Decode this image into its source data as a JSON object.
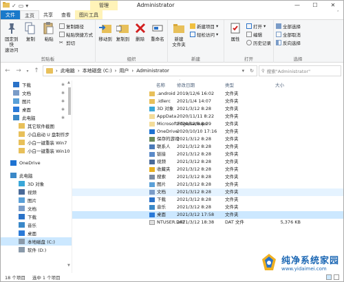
{
  "window": {
    "title": "Administrator",
    "context_tab_title": "管理",
    "buttons": {
      "minimize": "—",
      "maximize": "☐",
      "close": "✕"
    }
  },
  "ribbon_tabs": [
    {
      "label": "文件"
    },
    {
      "label": "主页"
    },
    {
      "label": "共享"
    },
    {
      "label": "查看"
    },
    {
      "label": "图片工具"
    }
  ],
  "ribbon": {
    "clipboard": {
      "label": "剪贴板",
      "pin": "固定到快\n速访问",
      "copy": "复制",
      "paste": "粘贴",
      "copy_path": "复制路径",
      "paste_shortcut": "粘贴快捷方式",
      "cut": "剪切"
    },
    "organize": {
      "label": "组织",
      "move_to": "移动到",
      "copy_to": "复制到",
      "delete": "删除",
      "rename": "重命名"
    },
    "new": {
      "label": "新建",
      "new_folder": "新建\n文件夹",
      "new_item": "新建项目",
      "easy_access": "轻松访问"
    },
    "open": {
      "label": "打开",
      "properties": "属性",
      "open": "打开",
      "edit": "编辑",
      "history": "历史记录"
    },
    "select": {
      "label": "选择",
      "select_all": "全部选择",
      "select_none": "全部取消",
      "invert": "反向选择"
    }
  },
  "address": {
    "path": [
      "此电脑",
      "本地磁盘 (C:)",
      "用户",
      "Administrator"
    ],
    "search_placeholder": "搜索\"Administrator\""
  },
  "nav": [
    {
      "label": "下载",
      "icon": "download-icon",
      "pinned": true,
      "level": 1
    },
    {
      "label": "文档",
      "icon": "document-icon",
      "pinned": true,
      "level": 1
    },
    {
      "label": "图片",
      "icon": "picture-icon",
      "pinned": true,
      "level": 1
    },
    {
      "label": "桌面",
      "icon": "desktop-icon",
      "pinned": true,
      "level": 1
    },
    {
      "label": "此电脑",
      "icon": "pc-icon",
      "pinned": true,
      "level": 1
    },
    {
      "label": "其它软件截图",
      "icon": "folder-icon",
      "pinned": false,
      "level": 2
    },
    {
      "label": "小白启动 U 盘制作步",
      "icon": "folder-icon",
      "pinned": false,
      "level": 2
    },
    {
      "label": "小白一键重装 Win7",
      "icon": "folder-icon",
      "pinned": false,
      "level": 2
    },
    {
      "label": "小白一键重装 Win10",
      "icon": "folder-icon",
      "pinned": false,
      "level": 2
    },
    {
      "label": "OneDrive",
      "icon": "cloud-icon",
      "pinned": false,
      "level": 0,
      "gap": true
    },
    {
      "label": "此电脑",
      "icon": "pc-icon",
      "pinned": false,
      "level": 0,
      "gap": true
    },
    {
      "label": "3D 对象",
      "icon": "3d-icon",
      "pinned": false,
      "level": 2
    },
    {
      "label": "视频",
      "icon": "video-icon",
      "pinned": false,
      "level": 2
    },
    {
      "label": "图片",
      "icon": "picture-icon",
      "pinned": false,
      "level": 2
    },
    {
      "label": "文档",
      "icon": "document-icon",
      "pinned": false,
      "level": 2
    },
    {
      "label": "下载",
      "icon": "download-icon",
      "pinned": false,
      "level": 2
    },
    {
      "label": "音乐",
      "icon": "music-icon",
      "pinned": false,
      "level": 2
    },
    {
      "label": "桌面",
      "icon": "desktop-icon",
      "pinned": false,
      "level": 2
    },
    {
      "label": "本地磁盘 (C:)",
      "icon": "drive-icon",
      "pinned": false,
      "level": 2,
      "selected": true
    },
    {
      "label": "软件 (D:)",
      "icon": "drive-icon",
      "pinned": false,
      "level": 2
    }
  ],
  "columns": {
    "name": "名称",
    "modified": "修改日期",
    "type": "类型",
    "size": "大小"
  },
  "files": [
    {
      "name": ".android",
      "date": "2019/12/6 16:02",
      "type": "文件夹",
      "size": "",
      "icon": "folder-icon"
    },
    {
      "name": ".idlerc",
      "date": "2021/1/4 14:07",
      "type": "文件夹",
      "size": "",
      "icon": "folder-icon"
    },
    {
      "name": "3D 对象",
      "date": "2021/3/12 8:28",
      "type": "文件夹",
      "size": "",
      "icon": "3d-icon"
    },
    {
      "name": "AppData",
      "date": "2020/11/11 8:22",
      "type": "文件夹",
      "size": "",
      "icon": "folder-light-icon"
    },
    {
      "name": "MicrosoftEdgeBackups",
      "date": "2020/12/8 8:39",
      "type": "文件夹",
      "size": "",
      "icon": "folder-light-icon"
    },
    {
      "name": "OneDrive",
      "date": "2020/10/10 17:16",
      "type": "文件夹",
      "size": "",
      "icon": "cloud-icon"
    },
    {
      "name": "保存的游戏",
      "date": "2021/3/12 8:28",
      "type": "文件夹",
      "size": "",
      "icon": "games-icon"
    },
    {
      "name": "联系人",
      "date": "2021/3/12 8:28",
      "type": "文件夹",
      "size": "",
      "icon": "contacts-icon"
    },
    {
      "name": "链接",
      "date": "2021/3/12 8:28",
      "type": "文件夹",
      "size": "",
      "icon": "link-icon"
    },
    {
      "name": "视频",
      "date": "2021/3/12 8:28",
      "type": "文件夹",
      "size": "",
      "icon": "video-icon"
    },
    {
      "name": "收藏夹",
      "date": "2021/3/12 8:28",
      "type": "文件夹",
      "size": "",
      "icon": "star-icon"
    },
    {
      "name": "搜索",
      "date": "2021/3/12 8:28",
      "type": "文件夹",
      "size": "",
      "icon": "search-icon"
    },
    {
      "name": "图片",
      "date": "2021/3/12 8:28",
      "type": "文件夹",
      "size": "",
      "icon": "picture-icon"
    },
    {
      "name": "文档",
      "date": "2021/3/12 8:28",
      "type": "文件夹",
      "size": "",
      "icon": "document-icon",
      "state": "hl"
    },
    {
      "name": "下载",
      "date": "2021/3/12 8:28",
      "type": "文件夹",
      "size": "",
      "icon": "download-icon"
    },
    {
      "name": "音乐",
      "date": "2021/3/12 8:28",
      "type": "文件夹",
      "size": "",
      "icon": "music-icon"
    },
    {
      "name": "桌面",
      "date": "2021/3/12 17:58",
      "type": "文件夹",
      "size": "",
      "icon": "desktop-icon",
      "state": "sel"
    },
    {
      "name": "NTUSER.DAT",
      "date": "2021/3/12 18:38",
      "type": "DAT 文件",
      "size": "5,376 KB",
      "icon": "file-icon"
    }
  ],
  "status": {
    "count": "18 个项目",
    "selection": "选中 1 个项目"
  },
  "watermark": {
    "title": "纯净系统家园",
    "url": "www.yidaimei.com"
  },
  "colors": {
    "file_tab": "#1979ca",
    "context_tab": "#fff3b8",
    "selected": "#cce8ff",
    "hover": "#e5f3ff",
    "folder": "#e8c05a"
  }
}
